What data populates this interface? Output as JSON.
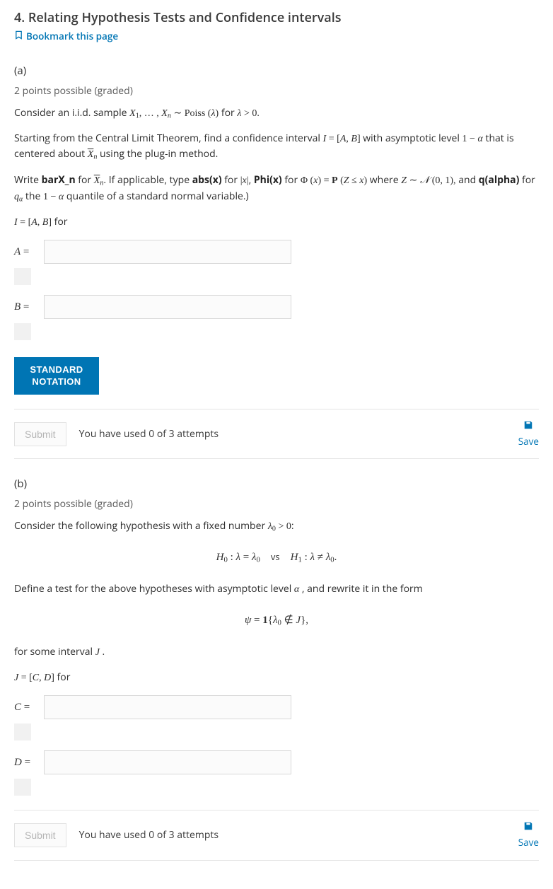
{
  "header": {
    "title": "4. Relating Hypothesis Tests and Confidence intervals",
    "bookmark_label": "Bookmark this page"
  },
  "part_a": {
    "label": "(a)",
    "points": "2 points possible (graded)",
    "p1_pre": "Consider an i.i.d. sample ",
    "p1_math1": "X₁, … , Xₙ ∼ Poiss (λ)",
    "p1_mid": " for ",
    "p1_math2": "λ > 0.",
    "p2_pre": "Starting from the Central Limit Theorem, find a confidence interval ",
    "p2_math1": "I = [A, B]",
    "p2_mid": " with asymptotic level ",
    "p2_math2": "1 − α",
    "p2_mid2": " that is centered about ",
    "p2_math3": "X̄ₙ",
    "p2_post": " using the plug-in method.",
    "p3_a": "Write ",
    "kw1": "barX_n",
    "p3_b": " for ",
    "p3_math1": "X̄ₙ",
    "p3_c": ". If applicable, type ",
    "kw2": "abs(x)",
    "p3_d": " for ",
    "p3_math2": "|x|",
    "p3_e": ", ",
    "kw3": "Phi(x)",
    "p3_f": " for ",
    "p3_math3": "Φ (x) = P (Z ≤ x)",
    "p3_g": " where ",
    "p3_math4": "Z ∼ 𝒩 (0, 1),",
    "p3_h": " and ",
    "kw4": "q(alpha)",
    "p3_i": " for ",
    "p3_math5": "qα",
    "p3_j": " the ",
    "p3_math6": "1 − α",
    "p3_k": " quantile of a standard normal variable.)",
    "interval_line": "I = [A, B] for",
    "field_A_label": "A =",
    "field_B_label": "B =",
    "std_notation_l1": "STANDARD",
    "std_notation_l2": "NOTATION",
    "submit_label": "Submit",
    "attempts_text": "You have used 0 of 3 attempts",
    "save_label": "Save"
  },
  "part_b": {
    "label": "(b)",
    "points": "2 points possible (graded)",
    "p1_pre": "Consider the following hypothesis with a fixed number ",
    "p1_math1": "λ₀ > 0",
    "p1_post": ":",
    "disp1": "H₀ : λ = λ₀    vs    H₁ : λ ≠ λ₀.",
    "p2_pre": "Define a test for the above hypotheses with asymptotic level ",
    "p2_math1": "α",
    "p2_post": " , and rewrite it in the form",
    "disp2": "ψ = 1{λ₀ ∉ J},",
    "p3_pre": "for some interval ",
    "p3_math1": "J",
    "p3_post": ".",
    "interval_line": "J = [C, D] for",
    "field_C_label": "C =",
    "field_D_label": "D =",
    "submit_label": "Submit",
    "attempts_text": "You have used 0 of 3 attempts",
    "save_label": "Save"
  }
}
